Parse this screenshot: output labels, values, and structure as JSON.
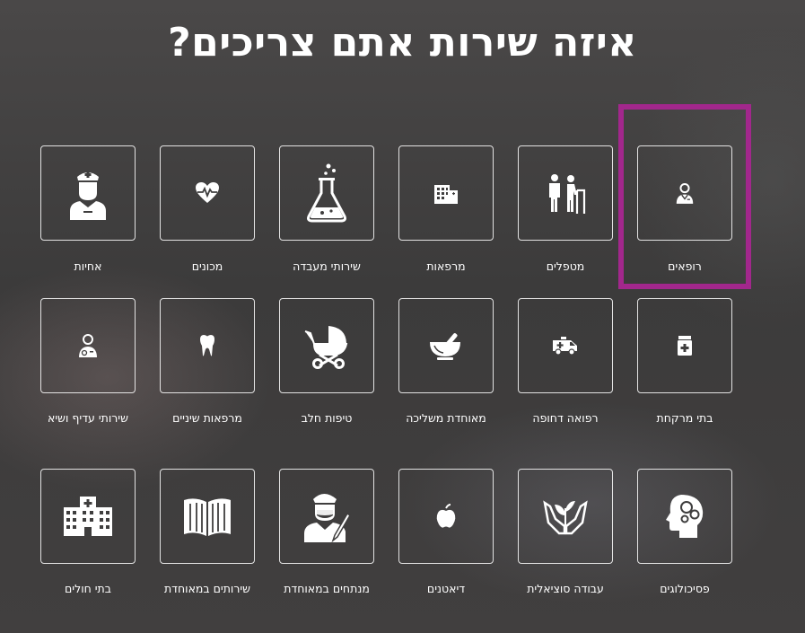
{
  "page": {
    "title": "איזה שירות אתם צריכים?",
    "highlight_color": "#a2278c"
  },
  "services": [
    {
      "label": "רופאים",
      "icon": "doctor-icon",
      "selected": true
    },
    {
      "label": "מטפלים",
      "icon": "caregiver-walker-icon"
    },
    {
      "label": "מרפאות",
      "icon": "clinic-building-icon"
    },
    {
      "label": "שירותי מעבדה",
      "icon": "lab-flask-icon"
    },
    {
      "label": "מכונים",
      "icon": "heart-pulse-icon"
    },
    {
      "label": "אחיות",
      "icon": "nurse-icon"
    },
    {
      "label": "בתי מרקחת",
      "icon": "medicine-bottle-icon"
    },
    {
      "label": "רפואה דחופה",
      "icon": "ambulance-icon"
    },
    {
      "label": "מאוחדת משליכה",
      "icon": "mortar-pestle-icon"
    },
    {
      "label": "טיפות חלב",
      "icon": "baby-stroller-icon"
    },
    {
      "label": "מרפאות שיניים",
      "icon": "tooth-icon"
    },
    {
      "label": "שירותי עדיף ושיא",
      "icon": "doctor-badge-icon"
    },
    {
      "label": "פסיכולוגים",
      "icon": "head-gears-icon"
    },
    {
      "label": "עבודה סוציאלית",
      "icon": "hands-plant-icon"
    },
    {
      "label": "דיאטנים",
      "icon": "apple-icon"
    },
    {
      "label": "מנתחים במאוחדת",
      "icon": "surgeon-icon"
    },
    {
      "label": "שירותים במאוחדת",
      "icon": "open-book-icon"
    },
    {
      "label": "בתי חולים",
      "icon": "hospital-icon"
    }
  ]
}
